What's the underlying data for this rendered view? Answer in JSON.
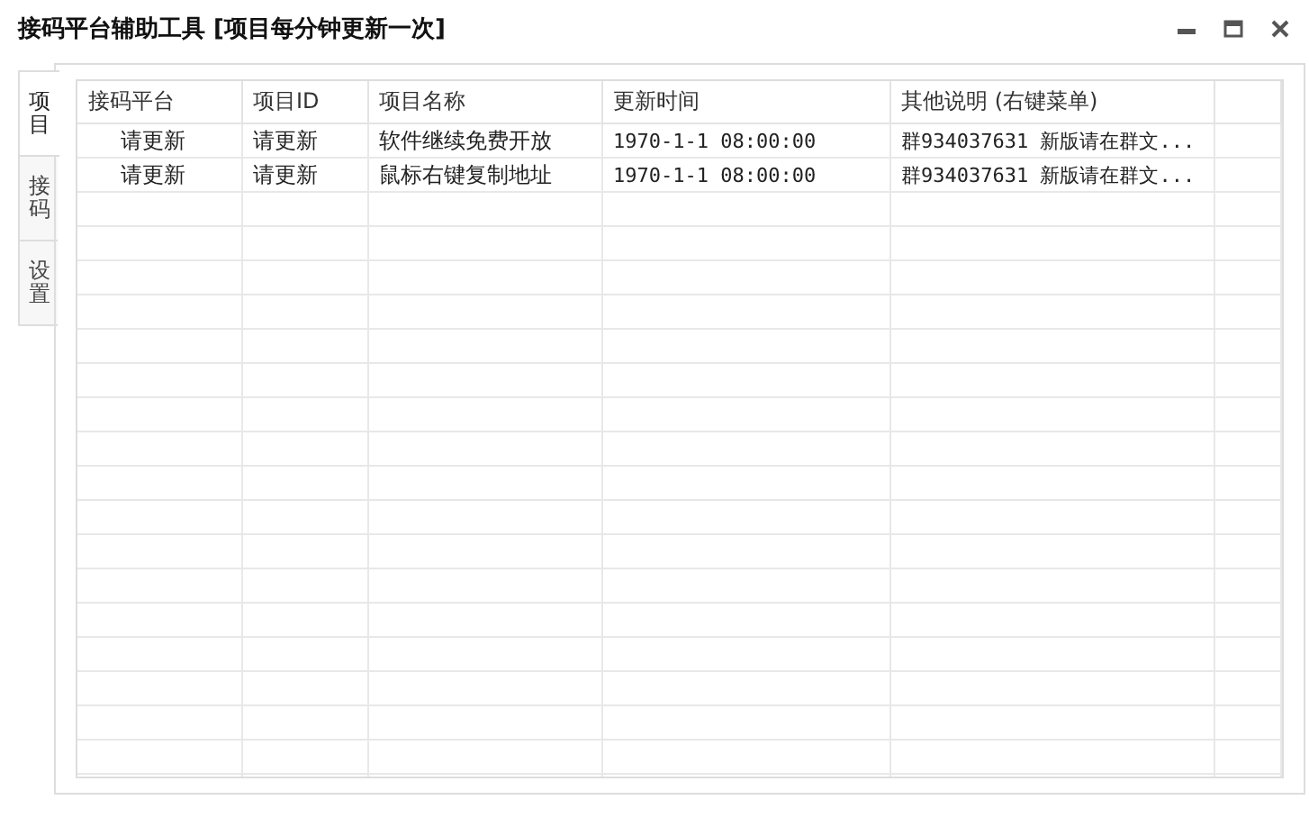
{
  "window": {
    "title": "接码平台辅助工具 [项目每分钟更新一次]"
  },
  "tabs": [
    {
      "label": "项目",
      "selected": true
    },
    {
      "label": "接码",
      "selected": false
    },
    {
      "label": "设置",
      "selected": false
    }
  ],
  "table": {
    "columns": [
      "接码平台",
      "项目ID",
      "项目名称",
      "更新时间",
      "其他说明 (右键菜单)"
    ],
    "rows": [
      [
        "请更新",
        "请更新",
        "软件继续免费开放",
        "1970-1-1 08:00:00",
        "群934037631 新版请在群文..."
      ],
      [
        "请更新",
        "请更新",
        "鼠标右键复制地址",
        "1970-1-1 08:00:00",
        "群934037631 新版请在群文..."
      ]
    ]
  }
}
